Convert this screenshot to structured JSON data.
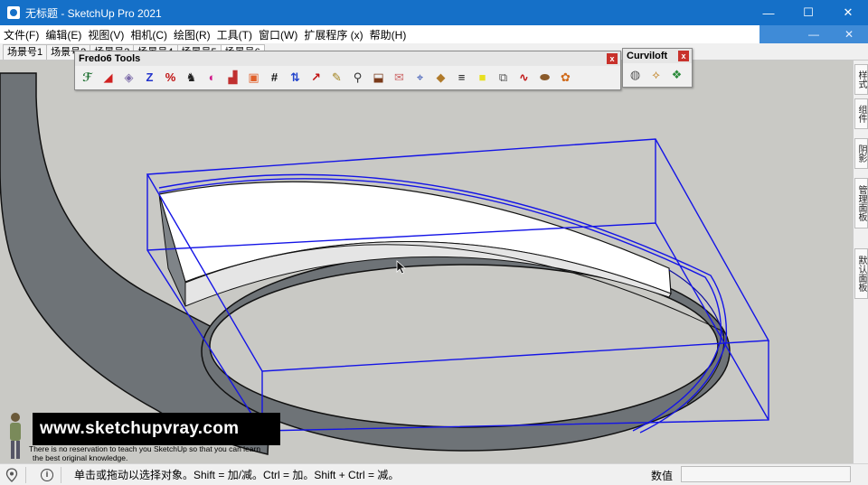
{
  "window": {
    "title": "无标题 - SketchUp Pro 2021",
    "minimize": "—",
    "maximize": "☐",
    "close": "✕"
  },
  "menu": {
    "items": [
      "文件(F)",
      "编辑(E)",
      "视图(V)",
      "相机(C)",
      "绘图(R)",
      "工具(T)",
      "窗口(W)",
      "扩展程序 (x)",
      "帮助(H)"
    ],
    "right_minimize": "—",
    "right_close": "✕"
  },
  "scenes": {
    "tabs": [
      "场景号1",
      "场景号2",
      "场景号3",
      "场景号4",
      "场景号5",
      "场景号6"
    ]
  },
  "fredo_toolbar": {
    "title": "Fredo6 Tools",
    "close": "x",
    "tools": [
      {
        "icon": "fredo-f6-icon",
        "glyph": "ℱ"
      },
      {
        "icon": "red-triangle-icon",
        "glyph": "◢"
      },
      {
        "icon": "cube-icon",
        "glyph": "◈"
      },
      {
        "icon": "zlayer-icon",
        "glyph": "Z"
      },
      {
        "icon": "percent-bar-icon",
        "glyph": "%"
      },
      {
        "icon": "cow-icon",
        "glyph": "♞"
      },
      {
        "icon": "color-wheel-icon",
        "glyph": "◐"
      },
      {
        "icon": "tray-icon",
        "glyph": "▟"
      },
      {
        "icon": "box-icon",
        "glyph": "▣"
      },
      {
        "icon": "hash-icon",
        "glyph": "#"
      },
      {
        "icon": "arrows-icon",
        "glyph": "⇅"
      },
      {
        "icon": "diagonal-icon",
        "glyph": "↗"
      },
      {
        "icon": "pencil-icon",
        "glyph": "✎"
      },
      {
        "icon": "magnifier-icon",
        "glyph": "⚲"
      },
      {
        "icon": "chair-icon",
        "glyph": "⬓"
      },
      {
        "icon": "envelope-icon",
        "glyph": "✉"
      },
      {
        "icon": "vertex-icon",
        "glyph": "⌖"
      },
      {
        "icon": "diamond-icon",
        "glyph": "◆"
      },
      {
        "icon": "lines-icon",
        "glyph": "≡"
      },
      {
        "icon": "square-two-icon",
        "glyph": "■"
      },
      {
        "icon": "windows-icon",
        "glyph": "⧉"
      },
      {
        "icon": "curve-icon",
        "glyph": "∿"
      },
      {
        "icon": "barrel-icon",
        "glyph": "⬬"
      },
      {
        "icon": "palette-icon",
        "glyph": "✿"
      }
    ]
  },
  "curviloft_toolbar": {
    "title": "Curviloft",
    "close": "x",
    "tools": [
      {
        "icon": "loft-shell-icon",
        "glyph": "◍"
      },
      {
        "icon": "loft-path-icon",
        "glyph": "⟡"
      },
      {
        "icon": "loft-skin-icon",
        "glyph": "❖"
      }
    ]
  },
  "side_panel": {
    "tabs": [
      "样式",
      "组件",
      "阴影",
      "管理面板",
      "默认面板"
    ]
  },
  "status": {
    "hint": "单击或拖动以选择对象。Shift = 加/减。Ctrl = 加。Shift + Ctrl = 减。",
    "measure_label": "数值",
    "measure_value": ""
  },
  "watermark": {
    "site": "www.sketchupvray.com",
    "line1": "There is no reservation to teach you SketchUp so that you can learn",
    "line2": "the best original knowledge."
  },
  "colors": {
    "titlebar": "#1570c8",
    "viewport_bg": "#c9c9c5",
    "selection_blue": "#1010e0",
    "face_dark": "#6e7377",
    "face_light": "#ffffff"
  }
}
